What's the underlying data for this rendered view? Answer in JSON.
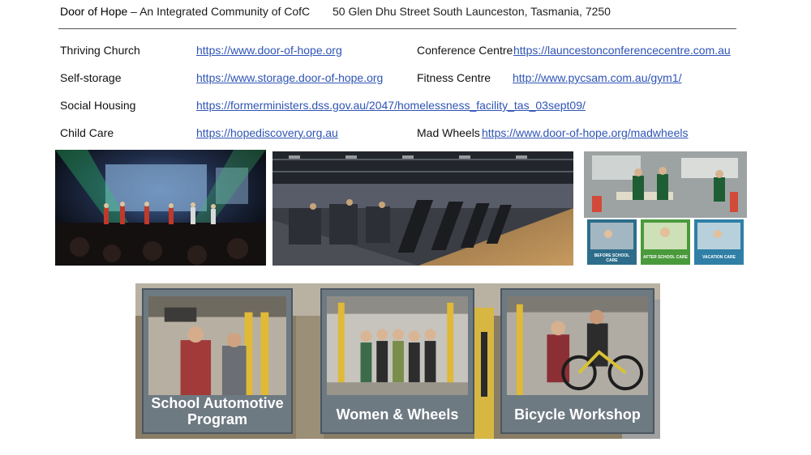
{
  "header": {
    "brand": "Door of Hope",
    "tagline": " – An Integrated Community of CofC",
    "address": "50 Glen Dhu Street South Launceston, Tasmania, 7250"
  },
  "services": [
    {
      "label": "Thriving Church",
      "url": "https://www.door-of-hope.org"
    },
    {
      "label": "Self-storage",
      "url": "https://www.storage.door-of-hope.org"
    },
    {
      "label": "Social Housing",
      "url": "https://formerministers.dss.gov.au/2047/homelessness_facility_tas_03sept09/"
    },
    {
      "label": "Child Care",
      "url": "https://hopediscovery.org.au"
    },
    {
      "label": "Conference Centre",
      "url": "https://launcestonconferencecentre.com.au"
    },
    {
      "label": "Fitness Centre",
      "url": "http://www.pycsam.com.au/gym1/"
    },
    {
      "label": "Mad Wheels",
      "url": "https://www.door-of-hope.org/madwheels"
    }
  ],
  "photos": {
    "childcare_captions": [
      "BEFORE SCHOOL CARE",
      "AFTER SCHOOL CARE",
      "VACATION CARE"
    ]
  },
  "programs": [
    {
      "caption": "School Automotive Program"
    },
    {
      "caption": "Women & Wheels"
    },
    {
      "caption": "Bicycle Workshop"
    }
  ]
}
